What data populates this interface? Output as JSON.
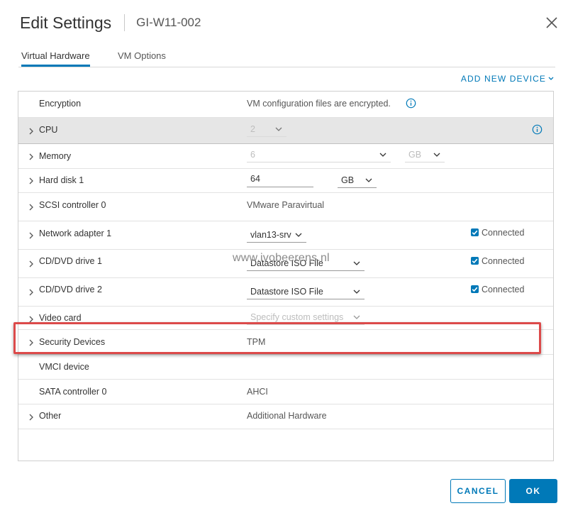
{
  "dialog": {
    "title": "Edit Settings",
    "vm_name": "GI-W11-002"
  },
  "tabs": [
    {
      "label": "Virtual Hardware",
      "active": true
    },
    {
      "label": "VM Options",
      "active": false
    }
  ],
  "add_device_label": "ADD NEW DEVICE",
  "rows": {
    "encryption": {
      "label": "Encryption",
      "value": "VM configuration files are encrypted."
    },
    "cpu": {
      "label": "CPU",
      "value": "2"
    },
    "memory": {
      "label": "Memory",
      "value": "6",
      "unit": "GB"
    },
    "hard_disk": {
      "label": "Hard disk 1",
      "value": "64",
      "unit": "GB"
    },
    "scsi": {
      "label": "SCSI controller 0",
      "value": "VMware Paravirtual"
    },
    "network": {
      "label": "Network adapter 1",
      "value": "vlan13-srv",
      "connected": "Connected"
    },
    "cd1": {
      "label": "CD/DVD drive 1",
      "value": "Datastore ISO File",
      "connected": "Connected"
    },
    "cd2": {
      "label": "CD/DVD drive 2",
      "value": "Datastore ISO File",
      "connected": "Connected"
    },
    "video": {
      "label": "Video card",
      "value": "Specify custom settings"
    },
    "security": {
      "label": "Security Devices",
      "value": "TPM"
    },
    "vmci": {
      "label": "VMCI device"
    },
    "sata": {
      "label": "SATA controller 0",
      "value": "AHCI"
    },
    "other": {
      "label": "Other",
      "value": "Additional Hardware"
    }
  },
  "watermark": "www.ivobeerens.nl",
  "buttons": {
    "cancel": "CANCEL",
    "ok": "OK"
  },
  "colors": {
    "accent": "#0079b8",
    "highlight": "#dc4a4a",
    "cpu_row_bg": "#e6e6e6"
  }
}
